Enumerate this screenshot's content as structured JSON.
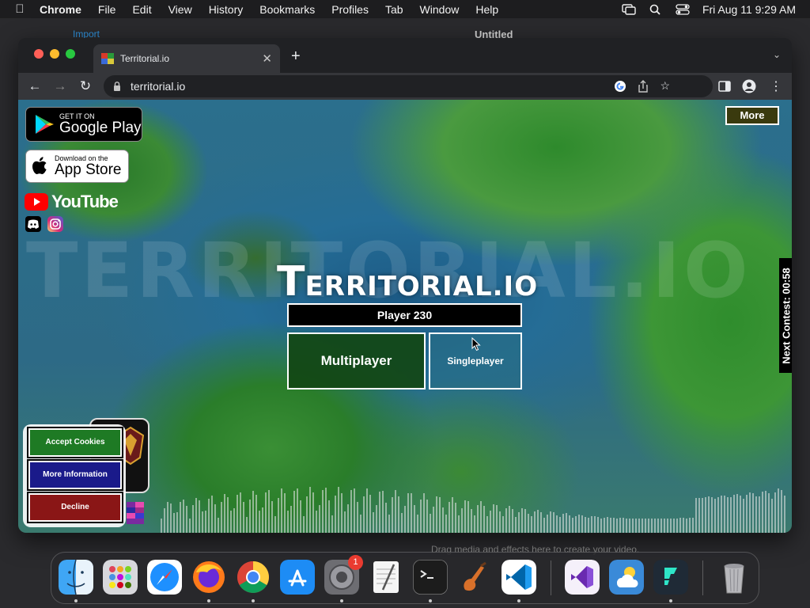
{
  "menubar": {
    "app": "Chrome",
    "items": [
      "File",
      "Edit",
      "View",
      "History",
      "Bookmarks",
      "Profiles",
      "Tab",
      "Window",
      "Help"
    ],
    "clock": "Fri Aug 11  9:29 AM"
  },
  "background_app": {
    "title": "Untitled",
    "import_label": "Import",
    "drop_hint": "Drag media and effects here to create your video."
  },
  "browser": {
    "tab_title": "Territorial.io",
    "url": "territorial.io"
  },
  "game": {
    "watermark": "TERRITORIAL.IO",
    "logo_cap": "T",
    "logo_rest": "ERRITORIAL.IO",
    "google_play": {
      "small": "GET IT ON",
      "big": "Google Play"
    },
    "app_store": {
      "small": "Download on the",
      "big": "App Store"
    },
    "youtube": "YouTube",
    "more_button": "More",
    "player_name": "Player 230",
    "multiplayer": "Multiplayer",
    "singleplayer": "Singleplayer",
    "next_contest": "Next Contest: 00:58",
    "cookies": {
      "accept": "Accept Cookies",
      "more_info": "More Information",
      "decline": "Decline"
    }
  },
  "dock": {
    "apps": [
      "Finder",
      "Launchpad",
      "Safari",
      "Firefox",
      "Chrome",
      "App Store",
      "System Settings",
      "TextEdit",
      "Terminal",
      "GarageBand",
      "Visual Studio Code",
      "Visual Studio",
      "Weather",
      "Filmora",
      "Trash"
    ],
    "settings_badge": "1"
  },
  "colors": {
    "multiplayer_bg": "#12461a",
    "accept_bg": "#1e7a24",
    "more_info_bg": "#1a1a8a",
    "decline_bg": "#8a1616",
    "more_bg": "#3a3a0e"
  }
}
